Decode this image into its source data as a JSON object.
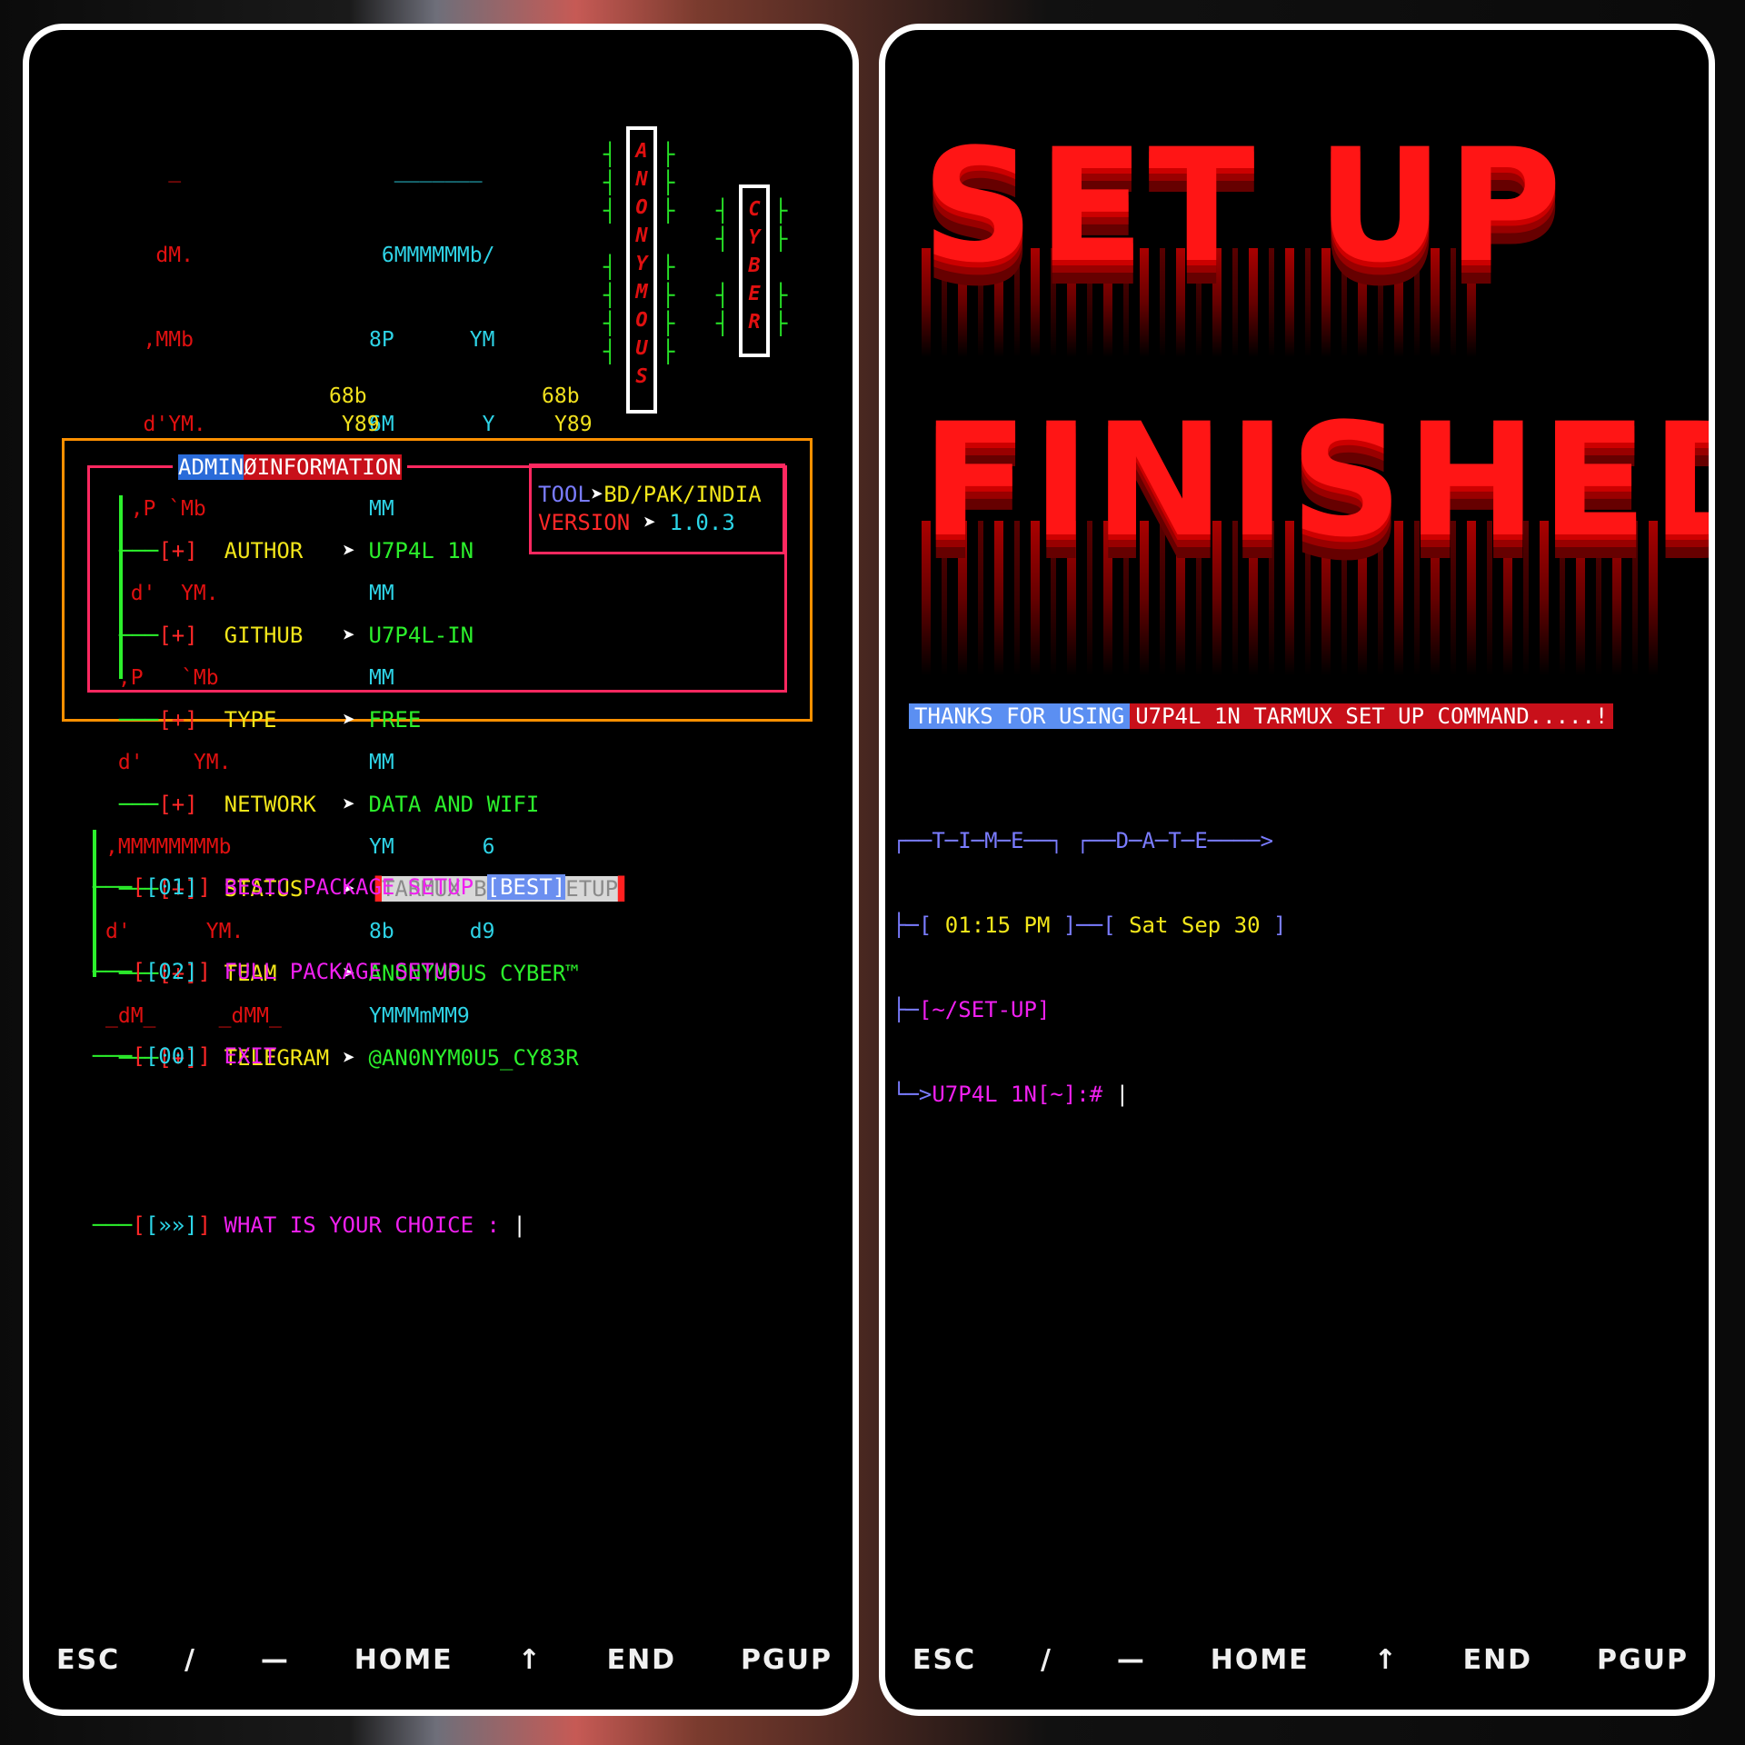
{
  "left": {
    "art_a": [
      "     _",
      "    dM.",
      "   ,MMb",
      "   d'YM.",
      "  ,P `Mb",
      "  d'  YM.",
      " ,P   `Mb",
      " d'    YM.",
      ",MMMMMMMMb",
      "d'      YM.",
      "_dM_     _dMM_"
    ],
    "art_c": [
      "  _______",
      " 6MMMMMMb/",
      "8P      YM",
      "6M       Y",
      "MM",
      "MM",
      "MM",
      "MM",
      "YM       6",
      "8b      d9",
      "YMMMmMM9"
    ],
    "art_y": {
      "row9_a": "68b",
      "row9_b": "68b",
      "row10_a": "Y89",
      "row10_b": "Y89"
    },
    "badge_anonymous": [
      "A",
      "N",
      "O",
      "N",
      "Y",
      "M",
      "O",
      "U",
      "S"
    ],
    "badge_cyber": [
      "C",
      "Y",
      "B",
      "E",
      "R"
    ],
    "info_title_a": "ADMIN",
    "info_title_b": "ØINFORMATION",
    "info_rows": [
      {
        "key": "AUTHOR",
        "value": "U7P4L 1N"
      },
      {
        "key": "GITHUB",
        "value": "U7P4L-IN"
      },
      {
        "key": "TYPE",
        "value": "FREE"
      },
      {
        "key": "NETWORK",
        "value": "DATA AND WIFI"
      },
      {
        "key": "STATUS",
        "value": "TARMUX BESIC SETUP"
      },
      {
        "key": "TEAM",
        "value": "ANONYMOUS CYBER™"
      },
      {
        "key": "TELEGRAM",
        "value": "@AN0NYM0U5_CY83R"
      }
    ],
    "bullet": "[+]",
    "arrow": "➤",
    "tool_label": "TOOL",
    "tool_value": "BD/PAK/INDIA",
    "version_label": "VERSION",
    "version_value": "1.0.3",
    "menu": [
      {
        "num": "[01]",
        "label": "BESIC PACKAGE SETUP",
        "tag": "[BEST]"
      },
      {
        "num": "[02]",
        "label": "FULL PACKAGE SETUP",
        "tag": ""
      },
      {
        "num": "[00]",
        "label": "EXIT",
        "tag": ""
      }
    ],
    "prompt_num": "[»»]",
    "prompt_text": "WHAT IS YOUR CHOICE :"
  },
  "right": {
    "headline_1": "SET UP",
    "headline_2": "FINISHED",
    "thanks_a": "THANKS FOR USING",
    "thanks_b": "U7P4L 1N TARMUX SET UP COMMAND.....!",
    "time_header": "┌──T─I─M─E──┐ ┌──D─A─T─E────>",
    "time_open": "├─[ ",
    "time_value": "01:15 PM",
    "time_mid": " ]──[ ",
    "date_value": "Sat Sep 30",
    "date_close": " ]",
    "path_prefix": "├─",
    "path_value": "[~/SET-UP]",
    "prompt_prefix": "└─>",
    "prompt_user": "U7P4L 1N",
    "prompt_rest": "[~]:#"
  },
  "footer_keys": [
    "ESC",
    "/",
    "—",
    "HOME",
    "↑",
    "END",
    "PGUP"
  ]
}
